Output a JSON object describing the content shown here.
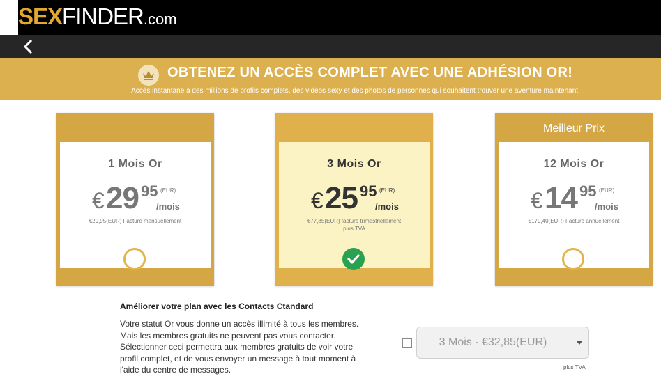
{
  "brand": {
    "sex": "SEX",
    "finder": "FINDER",
    "dotcom": ".com"
  },
  "banner": {
    "title": "OBTENEZ UN ACCÈS COMPLET AVEC UNE ADHÉSION OR!",
    "subtitle": "Accès instantané à des millions de profils complets, des vidéos sexy et des photos de personnes qui souhaitent trouver une aventure maintenant!"
  },
  "plans": [
    {
      "tag": "",
      "name": "1 Mois Or",
      "currency": "€",
      "price_int": "29",
      "price_cents": "95",
      "eur": "(EUR)",
      "per": "/mois",
      "billed": "€29,95(EUR) Facturé mensuellement",
      "tax": "",
      "selected": false
    },
    {
      "tag": "",
      "name": "3 Mois Or",
      "currency": "€",
      "price_int": "25",
      "price_cents": "95",
      "eur": "(EUR)",
      "per": "/mois",
      "billed": "€77,85(EUR) facturé trimestriellement",
      "tax": "plus TVA",
      "selected": true
    },
    {
      "tag": "Meilleur Prix",
      "name": "12 Mois Or",
      "currency": "€",
      "price_int": "14",
      "price_cents": "95",
      "eur": "(EUR)",
      "per": "/mois",
      "billed": "€179,40(EUR) Facturé annuellement",
      "tax": "",
      "selected": false
    }
  ],
  "upgrade": {
    "title": "Améliorer votre plan avec les Contacts Ctandard",
    "lines": [
      "Votre statut Or vous donne un accès illimité à tous les membres.",
      "Mais les membres gratuits ne peuvent pas vous contacter.",
      "Sélectionner ceci permettra aux membres gratuits de voir votre",
      "profil complet, et de vous envoyer un message à tout moment à",
      "l'aide du centre de messages."
    ],
    "select_value": "3 Mois - €32,85(EUR)",
    "tax_note": "plus TVA",
    "checked": false
  },
  "colors": {
    "gold": "#ddb04f",
    "selected_bg": "#fcf3c4",
    "check_green": "#2aa14f"
  },
  "icons": {
    "back": "chevron-left-icon",
    "crown": "crown-icon",
    "check": "check-icon"
  }
}
